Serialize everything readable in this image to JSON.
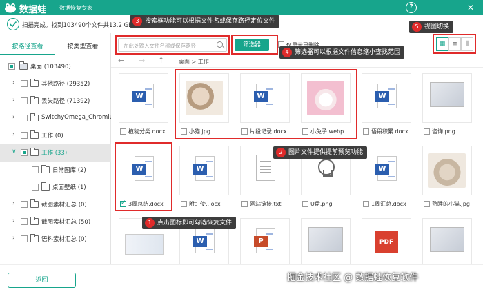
{
  "app": {
    "name": "数据蛙",
    "subtitle": "数据恢复专家",
    "help_glyph": "?",
    "minimize_glyph": "—",
    "close_glyph": "✕"
  },
  "status": {
    "text": "扫描完成。找到103490个文件共13.2 GB"
  },
  "sidebar": {
    "tabs": [
      {
        "label": "按路径查看",
        "active": true
      },
      {
        "label": "按类型查看",
        "active": false
      }
    ],
    "tree": [
      {
        "arrow": "",
        "label": "桌面 (103490)",
        "partial": true
      },
      {
        "arrow": "›",
        "label": "其他路径 (29352)",
        "partial": false
      },
      {
        "arrow": "›",
        "label": "丢失路径 (71392)",
        "partial": false
      },
      {
        "arrow": "›",
        "label": "SwitchyOmega_Chromium",
        "partial": false
      },
      {
        "arrow": "›",
        "label": "工作 (0)",
        "partial": false
      },
      {
        "arrow": "∨",
        "label": "工作 (33)",
        "partial": true,
        "selected": true
      },
      {
        "arrow": "",
        "label": "日常图库 (2)",
        "partial": false
      },
      {
        "arrow": "",
        "label": "桌面壁纸 (1)",
        "partial": false
      },
      {
        "arrow": "›",
        "label": "截图素材汇总 (0)",
        "partial": false
      },
      {
        "arrow": "›",
        "label": "截图素材汇总 (50)",
        "partial": false
      },
      {
        "arrow": "›",
        "label": "语料素材汇总 (0)",
        "partial": false
      }
    ]
  },
  "toolbar": {
    "search_placeholder": "在此处输入文件名称或保存路径",
    "filter_label": "筛选器",
    "only_checkbox_label": "仅显示已删除",
    "view_icons": [
      "▦",
      "≡",
      "⫼"
    ]
  },
  "nav": {
    "back_glyph": "←",
    "forward_glyph": "→",
    "up_glyph": "↑",
    "path": "桌面 > 工作"
  },
  "files": [
    {
      "name": "植物分类.docx",
      "type": "word"
    },
    {
      "name": "小猫.jpg",
      "type": "photo-cat"
    },
    {
      "name": "片段记录.docx",
      "type": "word"
    },
    {
      "name": "小兔子.webp",
      "type": "photo-rabbit"
    },
    {
      "name": "语段积累.docx",
      "type": "word"
    },
    {
      "name": "咨询.png",
      "type": "screen"
    },
    {
      "name": "3周总结.docx",
      "type": "word",
      "checked": true
    },
    {
      "name": "附：使...ocx",
      "type": "word"
    },
    {
      "name": "网站链接.txt",
      "type": "txt"
    },
    {
      "name": "U盘.png",
      "type": "png"
    },
    {
      "name": "1周汇总.docx",
      "type": "word"
    },
    {
      "name": "熟睡的小猫.jpg",
      "type": "photo-sleepycat"
    },
    {
      "name": "",
      "type": "wide"
    },
    {
      "name": "",
      "type": "word"
    },
    {
      "name": "",
      "type": "ppt"
    },
    {
      "name": "",
      "type": "screen"
    },
    {
      "name": "",
      "type": "pdf"
    },
    {
      "name": "",
      "type": "screen"
    }
  ],
  "file_badges": {
    "word": "W",
    "ppt": "P",
    "pdf": "PDF"
  },
  "footer": {
    "back_label": "返回",
    "watermark": "掘金技术社区 @ 数据蛙恢复软件"
  },
  "annotations": [
    {
      "num": "1",
      "text": "点击图标即可勾选恢复文件"
    },
    {
      "num": "2",
      "text": "图片文件提供提前预览功能"
    },
    {
      "num": "3",
      "text": "搜索框功能可以根据文件名或保存路径定位文件"
    },
    {
      "num": "4",
      "text": "筛选器可以根据文件信息缩小查找范围"
    },
    {
      "num": "5",
      "text": "视图切换"
    }
  ],
  "colors": {
    "brand": "#17a58c",
    "annotation_red": "#e02b2b",
    "note_bg": "#3d3d3d"
  }
}
